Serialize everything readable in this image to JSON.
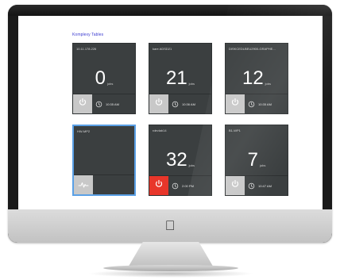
{
  "breadcrumb": "Komplexy Tables",
  "tiles": [
    {
      "name": "10.11.178.226",
      "value": "0",
      "unit": "jobs",
      "time": "10:35 AM",
      "power_state": "off"
    },
    {
      "name": "kare ADSD21",
      "value": "21",
      "unit": "jobs",
      "time": "10:36 AM",
      "power_state": "off"
    },
    {
      "name": "DISKCEDLBEU2900-GRAPHE...",
      "value": "12",
      "unit": "jobs",
      "time": "10:35 AM",
      "power_state": "off"
    },
    {
      "name": "HW-MP2",
      "value": "",
      "unit": "",
      "time": "",
      "power_state": "activity"
    },
    {
      "name": "rdevlab14",
      "value": "32",
      "unit": "jobs",
      "time": "2:00 PM",
      "power_state": "on"
    },
    {
      "name": "B1-WP1",
      "value": "7",
      "unit": "jobs",
      "time": "10:47 AM",
      "power_state": "off"
    }
  ],
  "colors": {
    "tile_bg": "#3b3f40",
    "power_on": "#e8362a",
    "power_off": "#c8c8c8",
    "selected_border": "#5aa0e6",
    "breadcrumb": "#3a3ad0"
  },
  "icons": {
    "power": "power-icon",
    "clock": "clock-icon",
    "activity": "activity-icon",
    "apple": "apple-logo-icon"
  }
}
